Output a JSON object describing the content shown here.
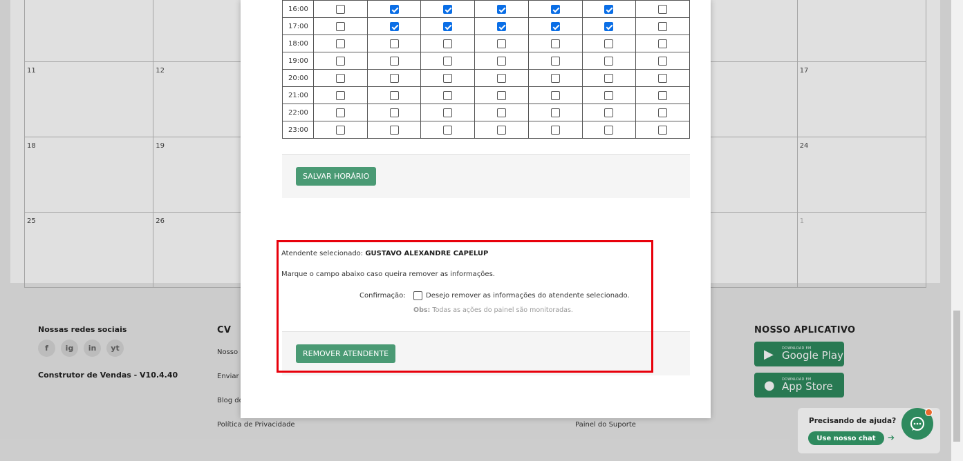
{
  "calendar": {
    "rows": [
      [
        "",
        "",
        "",
        "",
        "",
        "",
        ""
      ],
      [
        "11",
        "12",
        "",
        "",
        "",
        "",
        "17"
      ],
      [
        "18",
        "19",
        "",
        "",
        "",
        "",
        "24"
      ],
      [
        "25",
        "26",
        "",
        "",
        "",
        "",
        "1"
      ]
    ]
  },
  "schedule": {
    "rows": [
      {
        "hour": "16:00",
        "checks": [
          false,
          true,
          true,
          true,
          true,
          true,
          false
        ]
      },
      {
        "hour": "17:00",
        "checks": [
          false,
          true,
          true,
          true,
          true,
          true,
          false
        ]
      },
      {
        "hour": "18:00",
        "checks": [
          false,
          false,
          false,
          false,
          false,
          false,
          false
        ]
      },
      {
        "hour": "19:00",
        "checks": [
          false,
          false,
          false,
          false,
          false,
          false,
          false
        ]
      },
      {
        "hour": "20:00",
        "checks": [
          false,
          false,
          false,
          false,
          false,
          false,
          false
        ]
      },
      {
        "hour": "21:00",
        "checks": [
          false,
          false,
          false,
          false,
          false,
          false,
          false
        ]
      },
      {
        "hour": "22:00",
        "checks": [
          false,
          false,
          false,
          false,
          false,
          false,
          false
        ]
      },
      {
        "hour": "23:00",
        "checks": [
          false,
          false,
          false,
          false,
          false,
          false,
          false
        ]
      }
    ],
    "save_label": "SALVAR HORÁRIO"
  },
  "remove": {
    "selected_prefix": "Atendente selecionado:",
    "selected_name": "GUSTAVO ALEXANDRE CAPELUP",
    "instruction": "Marque o campo abaixo caso queira remover as informações.",
    "confirm_label": "Confirmação:",
    "confirm_text": "Desejo remover as informações do atendente selecionado.",
    "obs_label": "Obs:",
    "obs_text": "Todas as ações do painel são monitoradas.",
    "button_label": "REMOVER ATENDENTE"
  },
  "footer": {
    "social_title": "Nossas redes sociais",
    "social_icons": [
      "f",
      "ig",
      "in",
      "yt"
    ],
    "version": "Construtor de Vendas - V10.4.40",
    "cv_title": "CV",
    "cv_links": [
      "Nosso",
      "Enviar",
      "Blog do",
      "Política de Privacidade"
    ],
    "support_link": "Painel do Suporte",
    "app_title": "NOSSO APLICATIVO",
    "google_small": "DOWNLOAD EM",
    "google_big": "Google Play",
    "apple_small": "DOWNLOAD EM",
    "apple_big": "App Store"
  },
  "help": {
    "title": "Precisando de ajuda?",
    "button": "Use nosso chat",
    "arrow": "➔"
  },
  "colors": {
    "primary_green": "#4a9a74",
    "highlight_red": "#e8000b",
    "checkbox_blue": "#0a6ee6"
  }
}
